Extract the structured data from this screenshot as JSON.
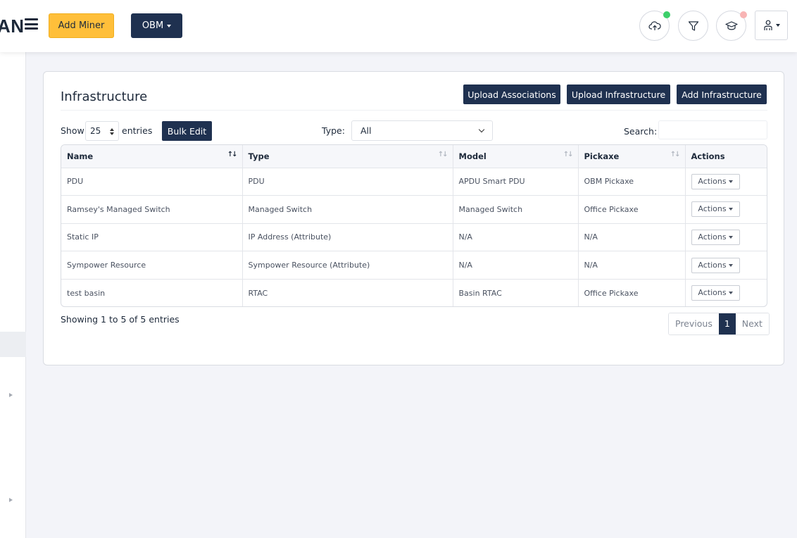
{
  "header": {
    "logo_text": "AN",
    "add_miner_label": "Add Miner",
    "org_label": "OBM",
    "status_colors": {
      "upload_dot": "#3ccf6a",
      "learn_dot": "#f8b4b4"
    }
  },
  "card": {
    "title": "Infrastructure",
    "buttons": {
      "upload_associations": "Upload Associations",
      "upload_infrastructure": "Upload Infrastructure",
      "add_infrastructure": "Add Infrastructure"
    },
    "controls": {
      "show_label": "Show",
      "page_size": "25",
      "entries_label": "entries",
      "bulk_edit": "Bulk Edit",
      "type_label": "Type:",
      "type_value": "All",
      "search_label": "Search:",
      "search_value": ""
    },
    "table": {
      "columns": [
        "Name",
        "Type",
        "Model",
        "Pickaxe",
        "Actions"
      ],
      "rows": [
        {
          "name": "PDU",
          "type": "PDU",
          "model": "APDU Smart PDU",
          "pickaxe": "OBM Pickaxe",
          "action": "Actions"
        },
        {
          "name": "Ramsey's Managed Switch",
          "type": "Managed Switch",
          "model": "Managed Switch",
          "pickaxe": "Office Pickaxe",
          "action": "Actions"
        },
        {
          "name": "Static IP",
          "type": "IP Address (Attribute)",
          "model": "N/A",
          "pickaxe": "N/A",
          "action": "Actions"
        },
        {
          "name": "Sympower Resource",
          "type": "Sympower Resource (Attribute)",
          "model": "N/A",
          "pickaxe": "N/A",
          "action": "Actions"
        },
        {
          "name": "test basin",
          "type": "RTAC",
          "model": "Basin RTAC",
          "pickaxe": "Office Pickaxe",
          "action": "Actions"
        }
      ]
    },
    "info": "Showing 1 to 5 of 5 entries",
    "pagination": {
      "previous": "Previous",
      "current": "1",
      "next": "Next"
    }
  }
}
